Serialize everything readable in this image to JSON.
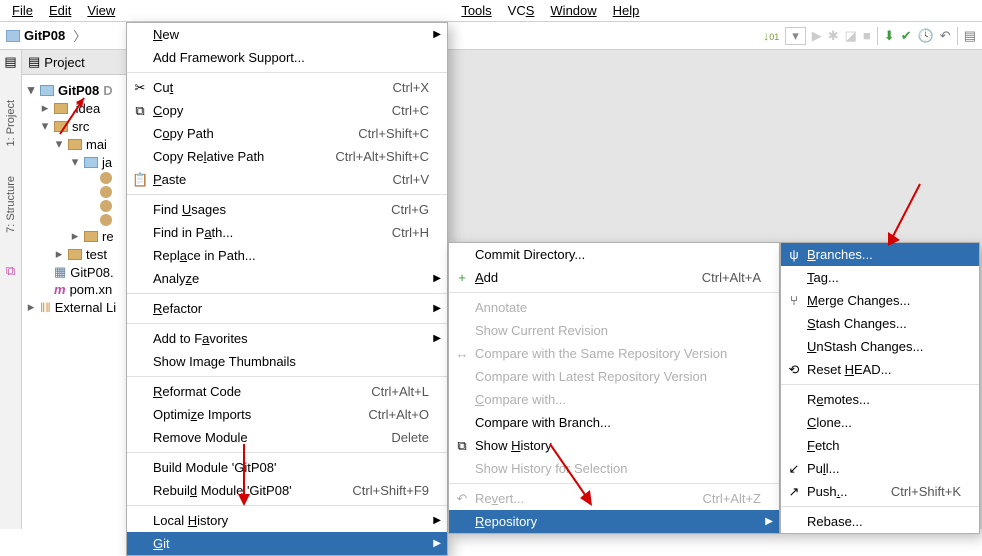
{
  "menubar": {
    "file": "File",
    "edit": "Edit",
    "view": "View",
    "tools": "Tools",
    "vcs": "VCS",
    "window": "Window",
    "help": "Help"
  },
  "breadcrumb": {
    "project": "GitP08"
  },
  "sidebar_labels": {
    "project": "1: Project",
    "structure": "7: Structure"
  },
  "project_tab": {
    "title": "Project"
  },
  "tree": {
    "root": "GitP08",
    "root_hint": "D",
    "idea": ".idea",
    "src": "src",
    "main": "mai",
    "java": "ja",
    "resources": "re",
    "test": "test",
    "iml": "GitP08.",
    "pom": "pom.xn",
    "external": "External Li",
    "iml_prefix": "m"
  },
  "context_menu": [
    {
      "label_html": "<span class='u'>N</span>ew",
      "shortcut": "",
      "arrow": true
    },
    {
      "label_html": "Add Framework Support...",
      "shortcut": ""
    },
    {
      "sep": true
    },
    {
      "label_html": "Cu<span class='u'>t</span>",
      "shortcut": "Ctrl+X",
      "icon": "✂"
    },
    {
      "label_html": "<span class='u'>C</span>opy",
      "shortcut": "Ctrl+C",
      "icon": "⧉"
    },
    {
      "label_html": "C<span class='u'>o</span>py Path",
      "shortcut": "Ctrl+Shift+C"
    },
    {
      "label_html": "Copy Re<span class='u'>l</span>ative Path",
      "shortcut": "Ctrl+Alt+Shift+C"
    },
    {
      "label_html": "<span class='u'>P</span>aste",
      "shortcut": "Ctrl+V",
      "icon": "📋"
    },
    {
      "sep": true
    },
    {
      "label_html": "Find <span class='u'>U</span>sages",
      "shortcut": "Ctrl+G"
    },
    {
      "label_html": "Find in P<span class='u'>a</span>th...",
      "shortcut": "Ctrl+H"
    },
    {
      "label_html": "Repl<span class='u'>a</span>ce in Path...",
      "shortcut": ""
    },
    {
      "label_html": "Analy<span class='u'>z</span>e",
      "shortcut": "",
      "arrow": true
    },
    {
      "sep": true
    },
    {
      "label_html": "<span class='u'>R</span>efactor",
      "shortcut": "",
      "arrow": true
    },
    {
      "sep": true
    },
    {
      "label_html": "Add to F<span class='u'>a</span>vorites",
      "shortcut": "",
      "arrow": true
    },
    {
      "label_html": "Show Image Thumbnails",
      "shortcut": ""
    },
    {
      "sep": true
    },
    {
      "label_html": "<span class='u'>R</span>eformat Code",
      "shortcut": "Ctrl+Alt+L"
    },
    {
      "label_html": "Optimi<span class='u'>z</span>e Imports",
      "shortcut": "Ctrl+Alt+O"
    },
    {
      "label_html": "Remove Module",
      "shortcut": "Delete"
    },
    {
      "sep": true
    },
    {
      "label_html": "Build Module 'GitP08'",
      "shortcut": ""
    },
    {
      "label_html": "Rebuil<span class='u'>d</span> Module 'GitP08'",
      "shortcut": "Ctrl+Shift+F9"
    },
    {
      "sep": true
    },
    {
      "label_html": "Local <span class='u'>H</span>istory",
      "shortcut": "",
      "arrow": true
    },
    {
      "label_html": "<span class='u'>G</span>it",
      "shortcut": "",
      "arrow": true,
      "selected": true
    }
  ],
  "git_menu": [
    {
      "label_html": "Commit Directory...",
      "shortcut": ""
    },
    {
      "label_html": "<span class='u'>A</span>dd",
      "shortcut": "Ctrl+Alt+A",
      "icon": "+",
      "iconcolor": "#3a9d3a"
    },
    {
      "sep": true
    },
    {
      "label_html": "Annotate",
      "disabled": true
    },
    {
      "label_html": "Show Current Revision",
      "disabled": true
    },
    {
      "label_html": "Compare with the Same Repository Version",
      "disabled": true,
      "icon": "↔"
    },
    {
      "label_html": "Compare with Latest Repository Version",
      "disabled": true
    },
    {
      "label_html": "<span class='u'>C</span>ompare with...",
      "disabled": true
    },
    {
      "label_html": "Compare with Branch...",
      "shortcut": ""
    },
    {
      "label_html": "Show <span class='u'>H</span>istory",
      "icon": "⧉"
    },
    {
      "label_html": "Show History for Selection",
      "disabled": true
    },
    {
      "sep": true
    },
    {
      "label_html": "Re<span class='u'>v</span>ert...",
      "shortcut": "Ctrl+Alt+Z",
      "icon": "↶",
      "disabled": true
    },
    {
      "label_html": "<span class='u'>R</span>epository",
      "shortcut": "",
      "arrow": true,
      "selected": true
    }
  ],
  "repo_menu": [
    {
      "label_html": "<span class='u'>B</span>ranches...",
      "icon": "ψ",
      "selected": true
    },
    {
      "label_html": "<span class='u'>T</span>ag..."
    },
    {
      "label_html": "<span class='u'>M</span>erge Changes...",
      "icon": "⑂"
    },
    {
      "label_html": "<span class='u'>S</span>tash Changes..."
    },
    {
      "label_html": "<span class='u'>U</span>nStash Changes..."
    },
    {
      "label_html": "Reset <span class='u'>H</span>EAD...",
      "icon": "⟲"
    },
    {
      "sep": true
    },
    {
      "label_html": "R<span class='u'>e</span>motes..."
    },
    {
      "label_html": "<span class='u'>C</span>lone..."
    },
    {
      "label_html": "<span class='u'>F</span>etch"
    },
    {
      "label_html": "Pu<span class='u'>l</span>l...",
      "icon": "↙"
    },
    {
      "label_html": "Push<span class='u'>.</span>..",
      "shortcut": "Ctrl+Shift+K",
      "icon": "↗"
    },
    {
      "sep": true
    },
    {
      "label_html": "Rebase..."
    }
  ]
}
